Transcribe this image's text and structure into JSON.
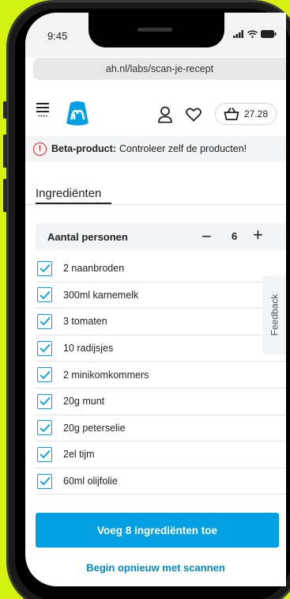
{
  "status": {
    "time": "9:45"
  },
  "browser": {
    "url": "ah.nl/labs/scan-je-recept"
  },
  "nav": {
    "menu_label": "menu",
    "cart_total": "27.28"
  },
  "banner": {
    "bold": "Beta-product:",
    "text": "Controleer zelf de producten!"
  },
  "ingredients": {
    "title": "Ingrediënten",
    "persons_label": "Aantal personen",
    "persons_count": "6",
    "items": [
      "2 naanbroden",
      "300ml karnemelk",
      "3 tomaten",
      "10 radijsjes",
      "2 minikomkommers",
      "20g munt",
      "20g peterselie",
      "2el tijm",
      "60ml olijfolie"
    ]
  },
  "feedback_label": "Feedback",
  "actions": {
    "add": "Voeg 8 ingrediënten toe",
    "restart": "Begin opnieuw met scannen"
  },
  "colors": {
    "accent": "#00a0e2",
    "alert": "#d9292b",
    "background": "#d4f10f"
  }
}
